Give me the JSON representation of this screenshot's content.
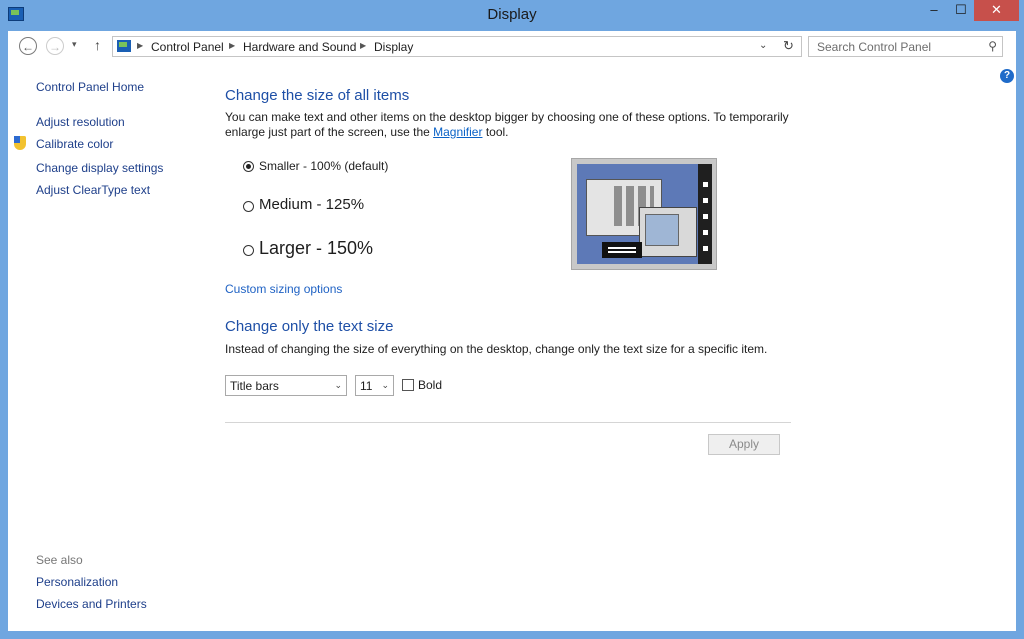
{
  "window": {
    "title": "Display",
    "controls": {
      "minimize": "–",
      "maximize": "☐",
      "close": "✕"
    }
  },
  "nav": {
    "back": "←",
    "forward": "→",
    "recent": "▾",
    "up": "↑",
    "breadcrumb": [
      "Control Panel",
      "Hardware and Sound",
      "Display"
    ],
    "dropdown": "⌄",
    "refresh": "↻",
    "search_placeholder": "Search Control Panel",
    "search_icon": "⚲"
  },
  "help": "?",
  "sidebar": {
    "home": "Control Panel Home",
    "items": [
      "Adjust resolution",
      "Calibrate color",
      "Change display settings",
      "Adjust ClearType text"
    ],
    "see_also_label": "See also",
    "see_also": [
      "Personalization",
      "Devices and Printers"
    ]
  },
  "main": {
    "heading1": "Change the size of all items",
    "desc1_a": "You can make text and other items on the desktop bigger by choosing one of these options. To temporarily enlarge just part of the screen, use the ",
    "desc1_link": "Magnifier",
    "desc1_b": " tool.",
    "options": [
      {
        "label": "Smaller - 100% (default)",
        "selected": true
      },
      {
        "label": "Medium - 125%",
        "selected": false
      },
      {
        "label": "Larger - 150%",
        "selected": false
      }
    ],
    "custom_link": "Custom sizing options",
    "heading2": "Change only the text size",
    "desc2": "Instead of changing the size of everything on the desktop, change only the text size for a specific item.",
    "item_select": "Title bars",
    "size_select": "11",
    "bold_label": "Bold",
    "bold_checked": false,
    "apply": "Apply"
  }
}
